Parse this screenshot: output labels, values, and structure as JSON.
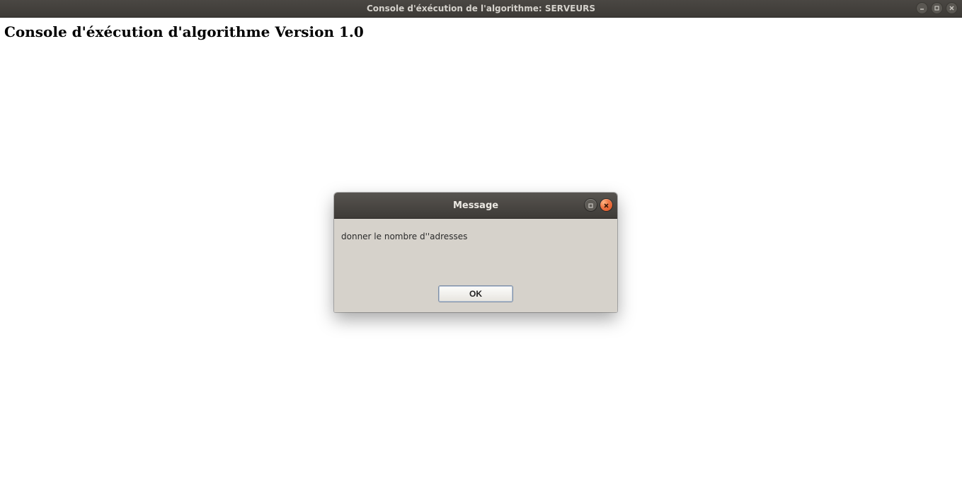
{
  "window": {
    "title": "Console d'éxécution de l'algorithme: SERVEURS",
    "controls": {
      "minimize": "minimize-icon",
      "maximize": "maximize-icon",
      "close": "close-icon"
    }
  },
  "page": {
    "heading": "Console d'éxécution d'algorithme Version 1.0"
  },
  "dialog": {
    "title": "Message",
    "message": "donner le nombre d''adresses",
    "ok_label": "OK",
    "controls": {
      "minimize": "minimize-icon",
      "close": "close-icon"
    }
  }
}
